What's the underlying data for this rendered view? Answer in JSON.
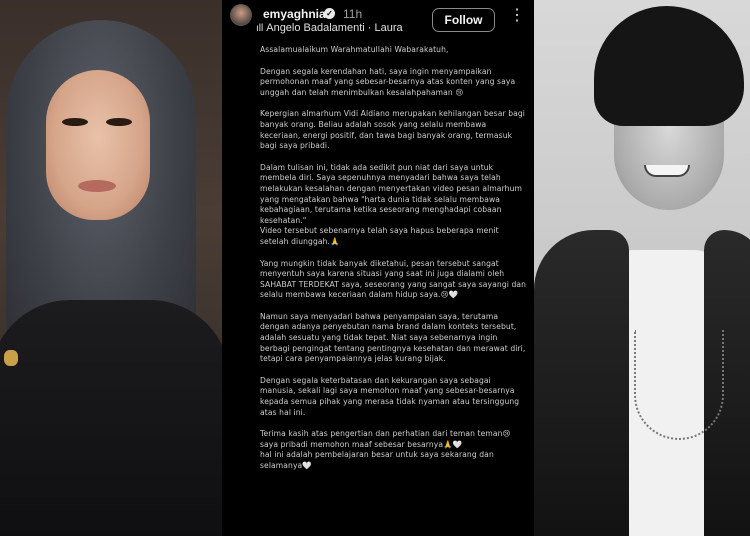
{
  "post": {
    "username": "emyaghnia",
    "time": "11h",
    "music": "Angelo Badalamenti · Laura",
    "follow_label": "Follow",
    "more_label": "⋮",
    "verified_label": "✓",
    "paragraphs": [
      "Assalamualaikum Warahmatullahi Wabarakatuh,",
      "Dengan segala kerendahan hati, saya ingin menyampaikan permohonan maaf yang sebesar-besarnya atas konten yang saya unggah dan telah menimbulkan kesalahpahaman 😢",
      "Kepergian almarhum Vidi Aldiano merupakan kehilangan besar bagi banyak orang. Beliau adalah sosok yang selalu membawa keceriaan, energi positif, dan tawa bagi banyak orang, termasuk bagi saya pribadi.",
      "Dalam tulisan ini, tidak ada sedikit pun niat dari saya untuk membela diri. Saya sepenuhnya menyadari bahwa saya telah melakukan kesalahan dengan menyertakan video pesan almarhum yang mengatakan bahwa \"harta dunia tidak selalu membawa kebahagiaan, terutama ketika seseorang menghadapi cobaan kesehatan.\"",
      "Video tersebut sebenarnya telah saya hapus beberapa menit setelah diunggah.🙏",
      "Yang mungkin tidak banyak diketahui, pesan tersebut sangat menyentuh saya karena situasi yang saat ini juga dialami oleh SAHABAT TERDEKAT saya, seseorang yang sangat saya sayangi dan selalu membawa keceriaan dalam hidup saya.😢🤍",
      "Namun saya menyadari bahwa penyampaian saya, terutama dengan adanya penyebutan nama brand dalam konteks tersebut, adalah sesuatu yang tidak tepat. Niat saya sebenarnya ingin berbagi pengingat tentang pentingnya kesehatan dan merawat diri, tetapi cara penyampaiannya jelas kurang bijak.",
      "Dengan segala keterbatasan dan kekurangan saya sebagai manusia, sekali lagi saya memohon maaf yang sebesar-besarnya kepada semua pihak yang merasa tidak nyaman atau tersinggung atas hal ini.",
      "Terima kasih atas pengertian dan perhatian dari teman teman😢",
      "saya pribadi memohon maaf sebesar besarnya🙏🤍",
      "hal ini adalah pembelajaran besar untuk saya sekarang dan selamanya🤍"
    ]
  }
}
